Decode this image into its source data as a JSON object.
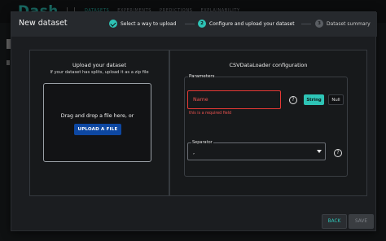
{
  "background": {
    "logo": "Dash",
    "nav": [
      "DATASETS",
      "EXPERIMENTS",
      "PREDICTIONS",
      "EXPLAINABILITY"
    ]
  },
  "dialog": {
    "title": "New dataset",
    "steps": [
      {
        "label": "Select a way to upload",
        "state": "done"
      },
      {
        "number": "2",
        "label": "Configure and upload your dataset",
        "state": "active"
      },
      {
        "number": "3",
        "label": "Dataset summary",
        "state": "pending"
      }
    ],
    "upload": {
      "title": "Upload your dataset",
      "subtitle": "If your dataset has splits, upload it as a zip file",
      "drop_text": "Drag and drop a file here, or",
      "button": "UPLOAD A FILE"
    },
    "config": {
      "title": "CSVDataLoader configuration",
      "params_label": "Parameters",
      "name_label": "Name",
      "name_error": "this is a required field",
      "type_string": "String",
      "type_null": "Null",
      "separator_label": "Separator",
      "separator_value": ","
    },
    "footer": {
      "back": "BACK",
      "save": "SAVE"
    }
  },
  "colors": {
    "accent": "#2ec4b6",
    "error": "#e53935",
    "primary_button": "#0d47a1"
  }
}
